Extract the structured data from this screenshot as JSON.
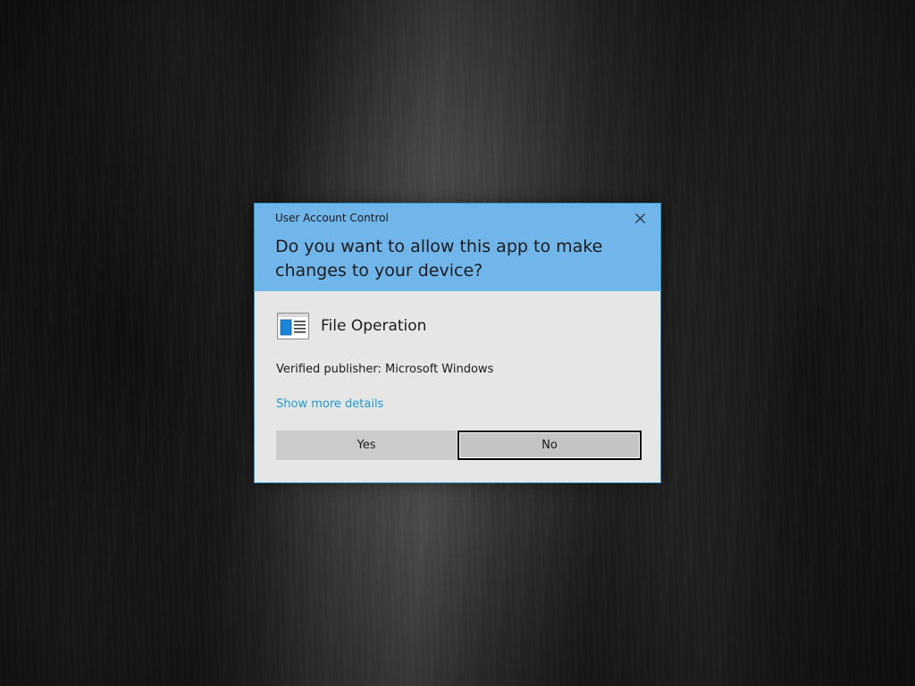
{
  "dialog": {
    "title": "User Account Control",
    "question": "Do you want to allow this app to make changes to your device?",
    "app_name": "File Operation",
    "app_icon": "file-operation-icon",
    "publisher_label": "Verified publisher: ",
    "publisher_value": "Microsoft Windows",
    "details_link": "Show more details",
    "yes_label": "Yes",
    "no_label": "No",
    "focused_button": "No",
    "close_icon": "close-icon"
  },
  "colors": {
    "header": "#71b6ea",
    "body": "#e6e6e6",
    "border": "#2a9fd6",
    "link": "#1a9bd1",
    "button": "#cccccc"
  }
}
